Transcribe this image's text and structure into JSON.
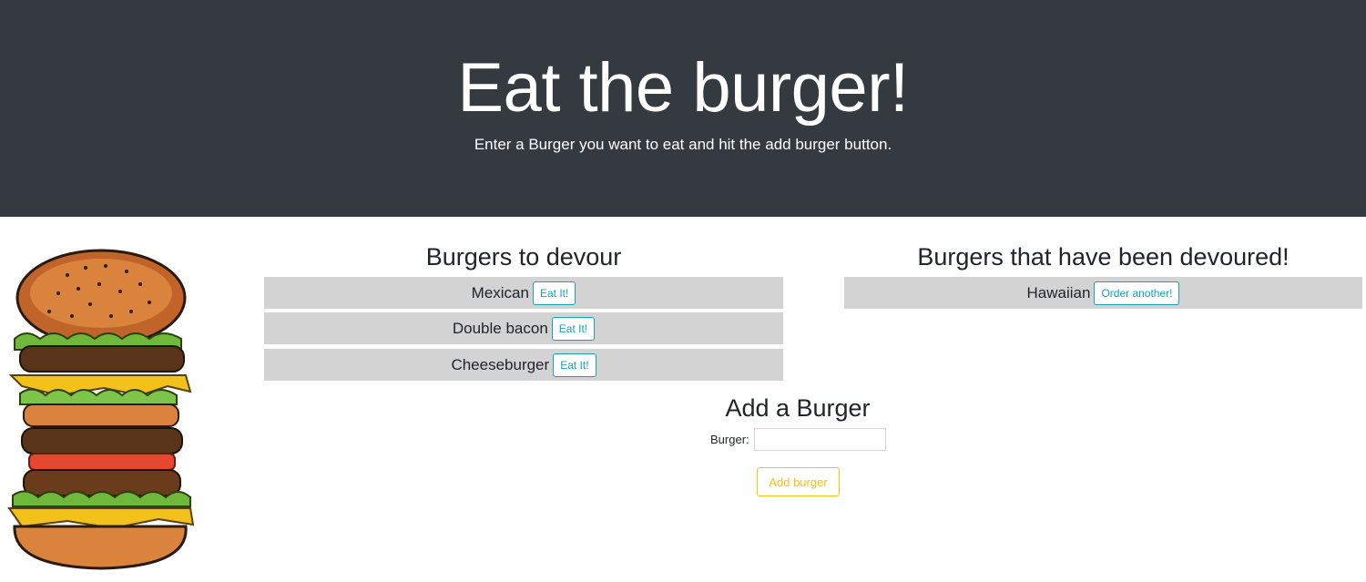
{
  "header": {
    "title": "Eat the burger!",
    "subtitle": "Enter a Burger you want to eat and hit the add burger button."
  },
  "to_devour": {
    "heading": "Burgers to devour",
    "button_label": "Eat It!",
    "items": [
      {
        "name": "Mexican"
      },
      {
        "name": "Double bacon"
      },
      {
        "name": "Cheeseburger"
      }
    ]
  },
  "devoured": {
    "heading": "Burgers that have been devoured!",
    "button_label": "Order another!",
    "items": [
      {
        "name": "Hawaiian"
      }
    ]
  },
  "add_form": {
    "heading": "Add a Burger",
    "label": "Burger:",
    "input_value": "",
    "submit_label": "Add burger"
  },
  "colors": {
    "header_bg": "#343a40",
    "row_bg": "#d3d3d3",
    "info": "#17a2b8",
    "warning": "#ffc107"
  }
}
